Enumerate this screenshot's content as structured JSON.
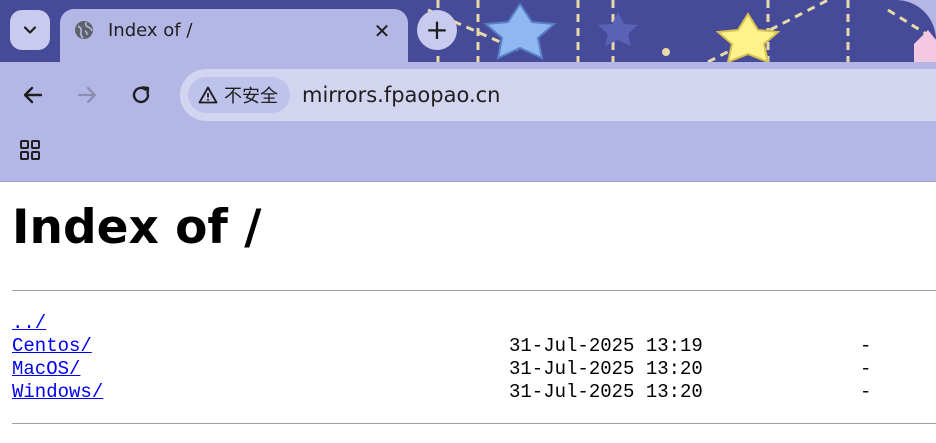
{
  "browser": {
    "tab": {
      "title": "Index of /",
      "close_glyph": "✕"
    },
    "new_tab_glyph": "+",
    "security_label": "不安全",
    "url": "mirrors.fpaopao.cn",
    "icons": {
      "tab_search": "chevron-down-icon",
      "favicon": "globe-icon",
      "back": "arrow-left-icon",
      "forward": "arrow-right-icon",
      "reload": "reload-icon",
      "warning": "warning-triangle-icon",
      "apps": "apps-grid-icon"
    },
    "colors": {
      "frame": "#b4b7e6",
      "omnibox": "#d2d4f0",
      "theme_art": "#454b98"
    }
  },
  "page": {
    "heading": "Index of /",
    "parent_link": "../",
    "entries": [
      {
        "name": "Centos/",
        "date": "31-Jul-2025 13:19",
        "size": "-"
      },
      {
        "name": "MacOS/",
        "date": "31-Jul-2025 13:20",
        "size": "-"
      },
      {
        "name": "Windows/",
        "date": "31-Jul-2025 13:20",
        "size": "-"
      }
    ],
    "link_color": "#0000ee"
  }
}
